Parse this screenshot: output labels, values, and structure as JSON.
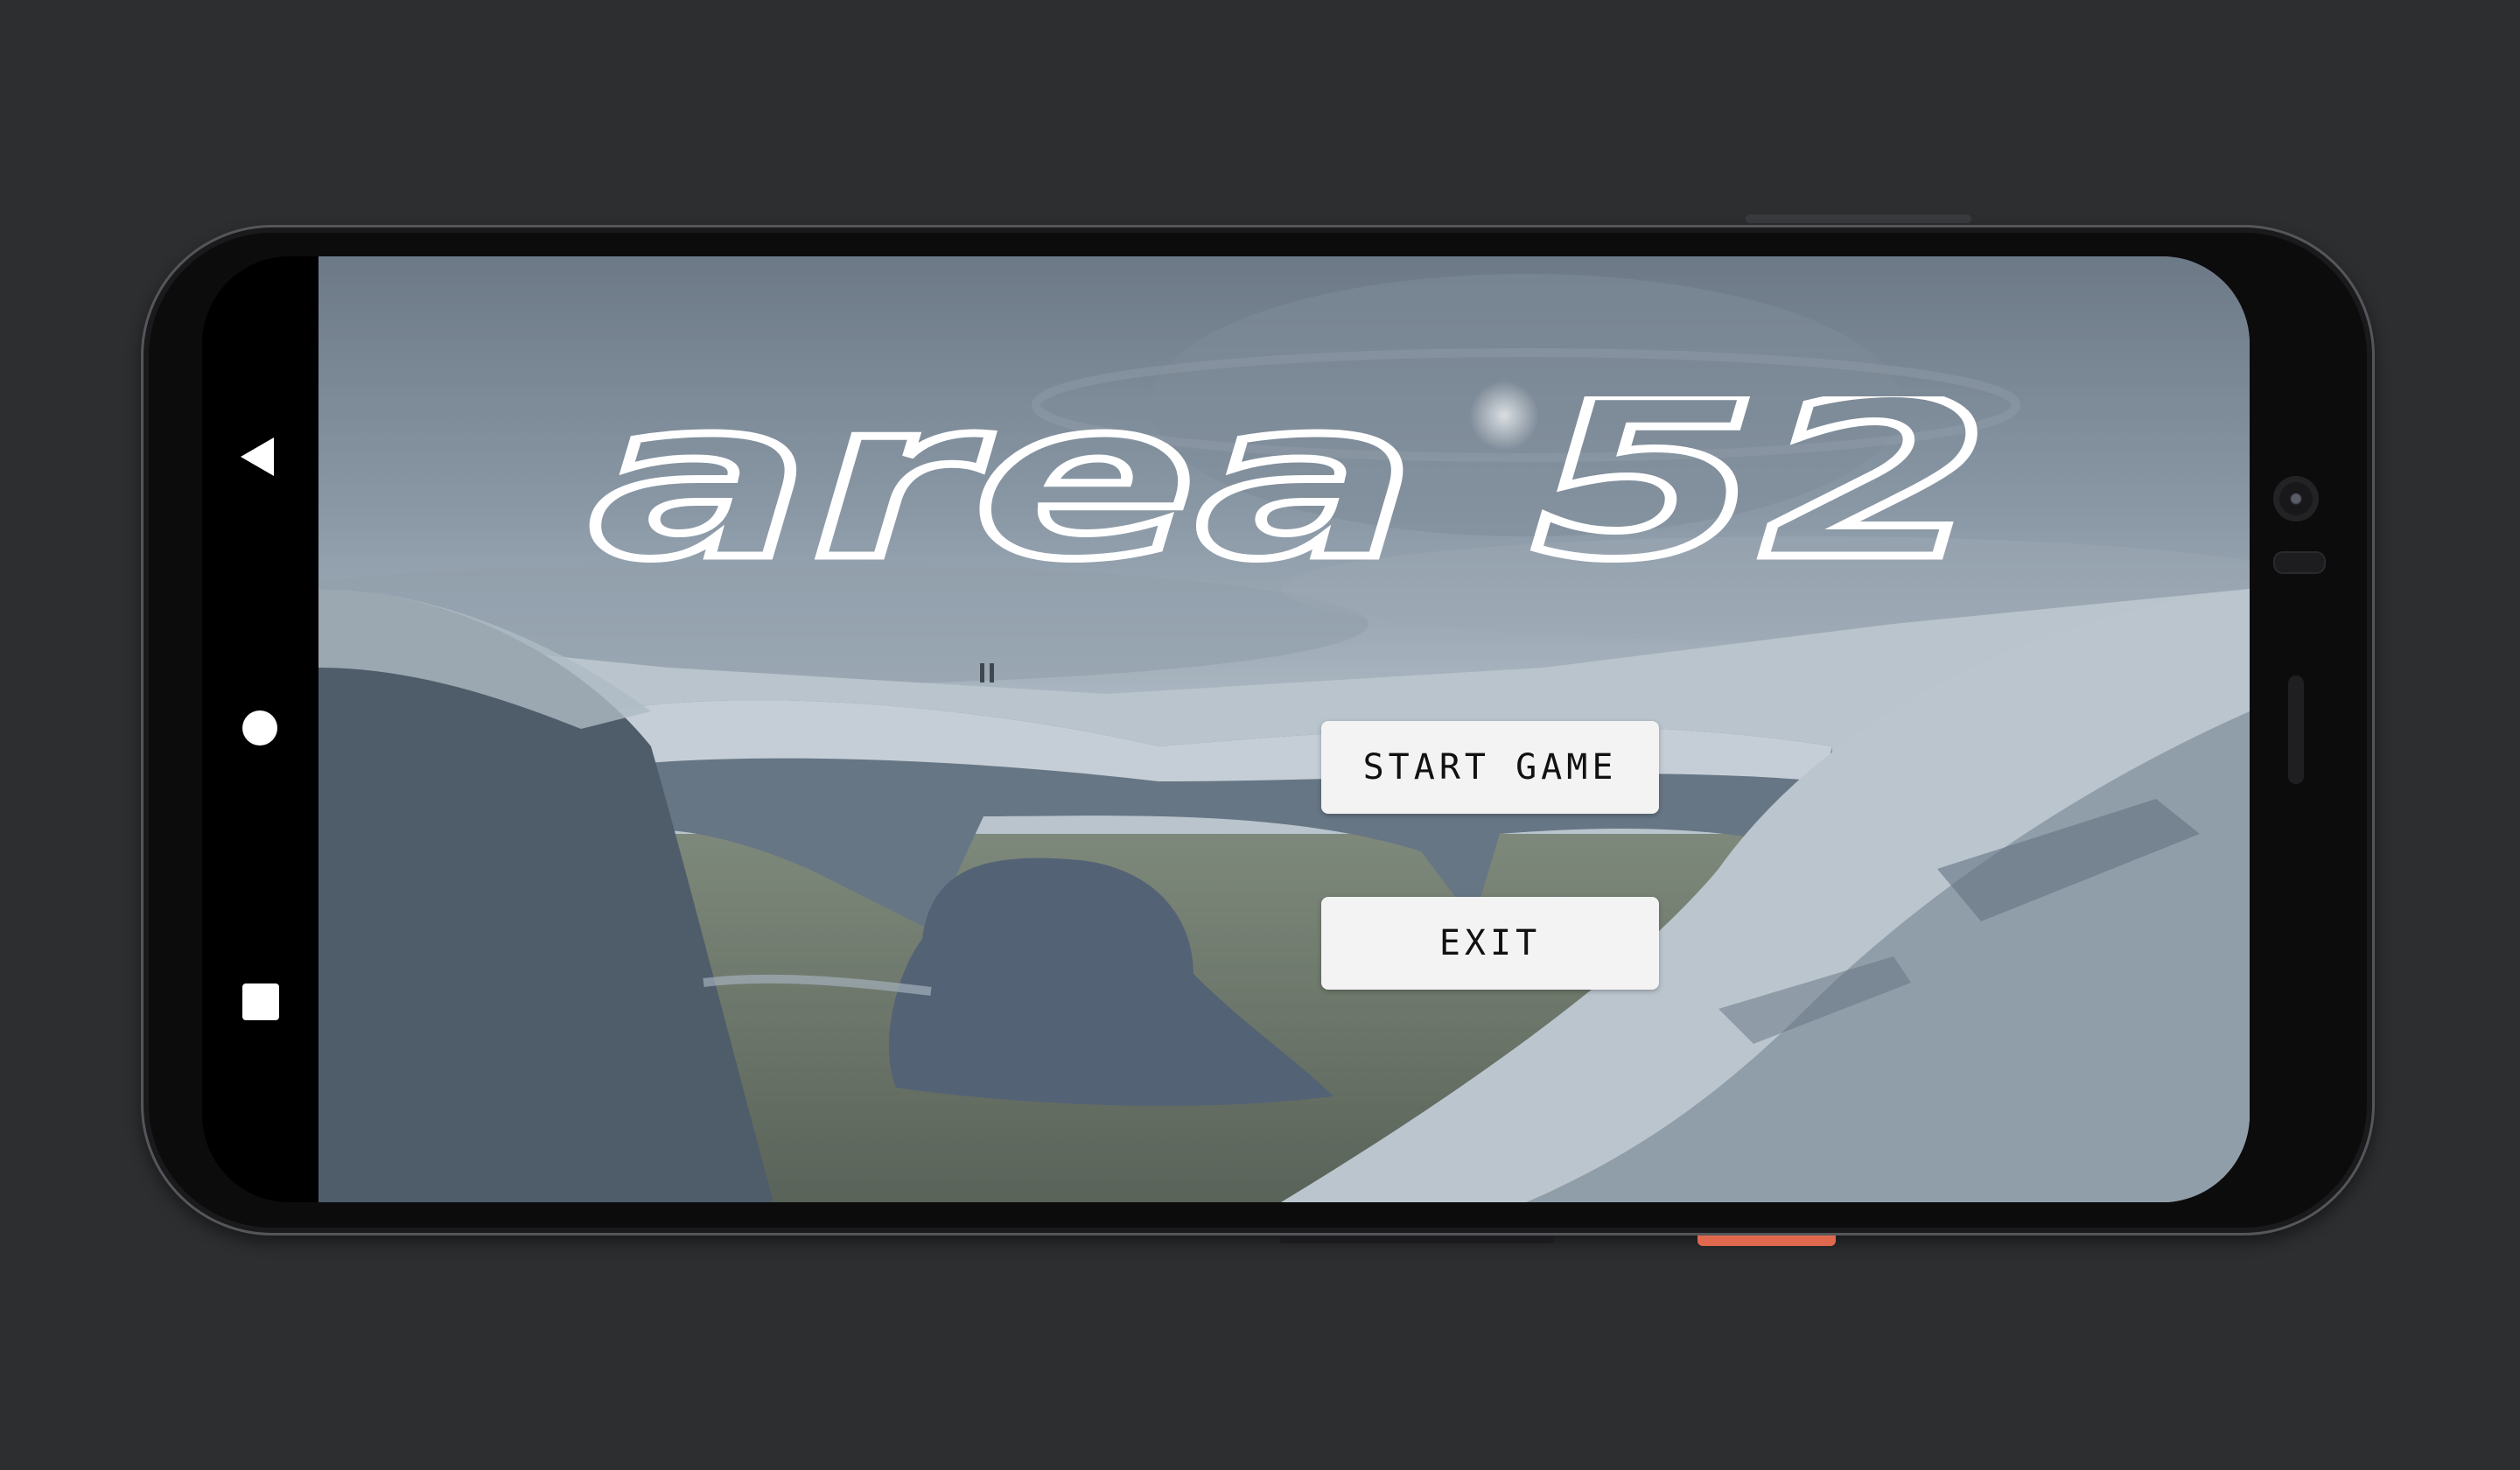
{
  "game": {
    "title_logo": "area 52",
    "menu": {
      "start_label": "START GAME",
      "exit_label": "EXIT"
    }
  },
  "device": {
    "nav_icons": [
      "back-icon",
      "home-icon",
      "recents-icon"
    ],
    "accent_power_button": "#e0694d",
    "frame_color": "#0c0c0d",
    "backdrop_color": "#2d2e30"
  }
}
